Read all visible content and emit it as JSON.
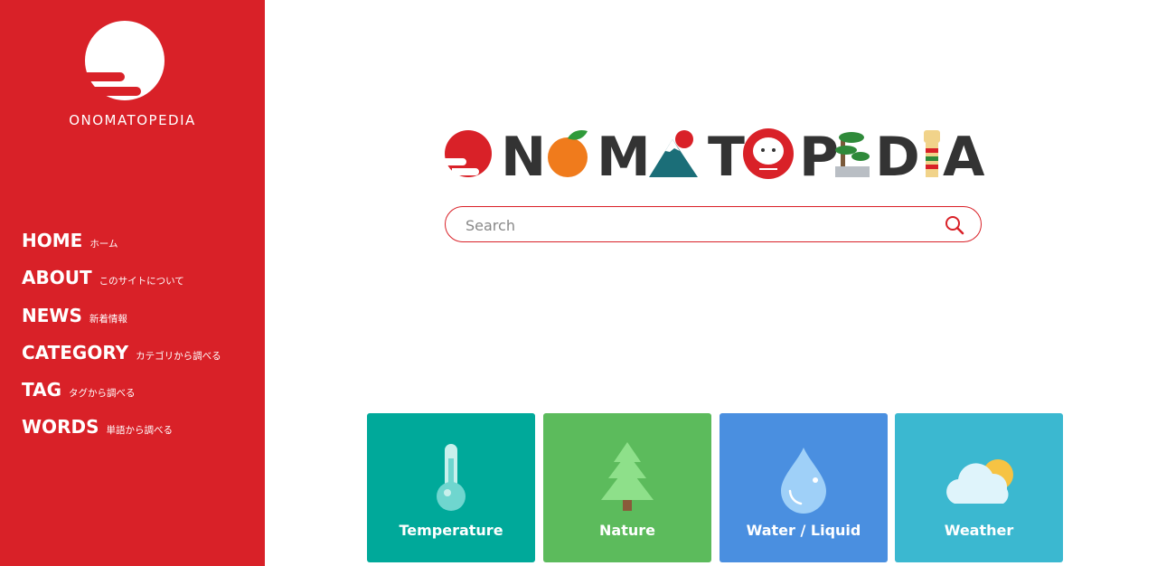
{
  "sidebar": {
    "brand": "ONOMATOPEDIA",
    "nav": [
      {
        "label": "HOME",
        "sub": "ホーム"
      },
      {
        "label": "ABOUT",
        "sub": "このサイトについて"
      },
      {
        "label": "NEWS",
        "sub": "新着情報"
      },
      {
        "label": "CATEGORY",
        "sub": "カテゴリから調べる"
      },
      {
        "label": "TAG",
        "sub": "タグから調べる"
      },
      {
        "label": "WORDS",
        "sub": "単語から調べる"
      }
    ]
  },
  "wordmark": {
    "letters": [
      "O",
      "N",
      "O",
      "M",
      "A",
      "T",
      "O",
      "P",
      "E",
      "D",
      "I",
      "A"
    ]
  },
  "search": {
    "placeholder": "Search"
  },
  "categories": [
    {
      "label": "Temperature",
      "color": "#00a99a",
      "icon": "thermometer-icon"
    },
    {
      "label": "Nature",
      "color": "#5cbb5c",
      "icon": "tree-icon"
    },
    {
      "label": "Water / Liquid",
      "color": "#4a8fe0",
      "icon": "water-drop-icon"
    },
    {
      "label": "Weather",
      "color": "#3bb8d0",
      "icon": "cloud-sun-icon"
    }
  ],
  "colors": {
    "brand_red": "#d92128",
    "text_dark": "#333333"
  }
}
